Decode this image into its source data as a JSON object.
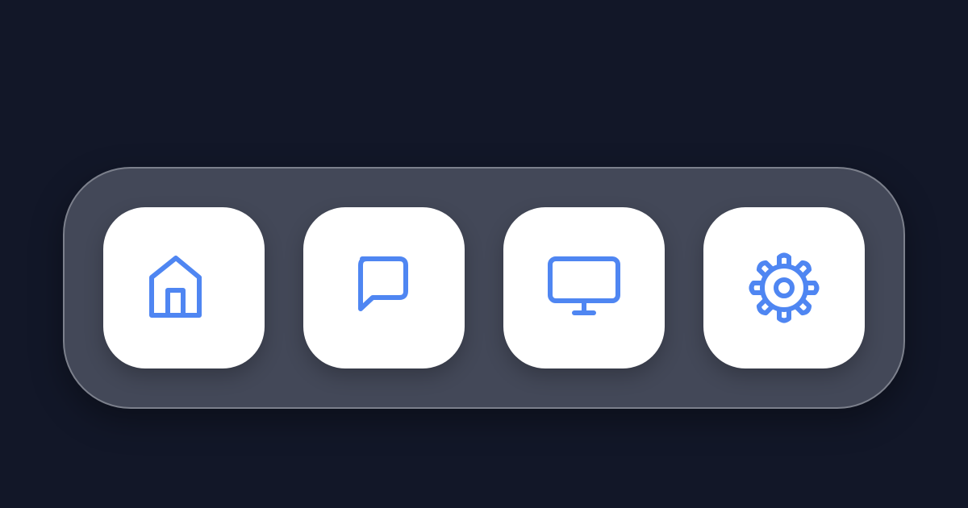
{
  "dock": {
    "accent_color": "#4f86f2",
    "items": [
      {
        "id": "home",
        "icon": "home-icon"
      },
      {
        "id": "messages",
        "icon": "chat-bubble-icon"
      },
      {
        "id": "display",
        "icon": "monitor-icon"
      },
      {
        "id": "settings",
        "icon": "gear-icon"
      }
    ]
  }
}
